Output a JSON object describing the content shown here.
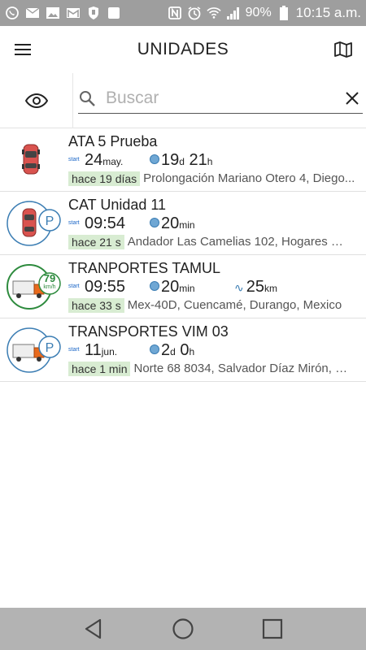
{
  "status_bar": {
    "icons": [
      "whatsapp-icon",
      "mail-icon",
      "image-icon",
      "gmail-icon",
      "shield-icon",
      "square-app-icon",
      "nfc-icon",
      "alarm-icon",
      "wifi-icon",
      "signal-icon",
      "battery-icon"
    ],
    "battery": "90%",
    "time": "10:15 a.m."
  },
  "appbar": {
    "title": "UNIDADES",
    "menu_icon": "menu-icon",
    "map_icon": "map-icon"
  },
  "search": {
    "placeholder": "Buscar",
    "value": "",
    "eye_icon": "eye-icon",
    "search_icon": "search-icon",
    "clear_icon": "close-icon"
  },
  "units": [
    {
      "name": "ATA 5 Prueba",
      "icon": "car-icon",
      "start_label": "start",
      "start_main": "24",
      "start_unit": "may.",
      "duration_a": "19",
      "duration_a_unit": "d",
      "duration_b": "21",
      "duration_b_unit": "h",
      "distance": "",
      "distance_unit": "",
      "ago": "hace 19 días",
      "address": "Prolongación Mariano Otero 4, Diego..."
    },
    {
      "name": "CAT Unidad 11",
      "icon": "car-parked-icon",
      "start_label": "start",
      "start_main": "09:54",
      "start_unit": "",
      "duration_a": "20",
      "duration_a_unit": "min",
      "duration_b": "",
      "duration_b_unit": "",
      "distance": "",
      "distance_unit": "",
      "ago": "hace 21 s",
      "address": "Andador Las Camelias 102, Hogares Fe..."
    },
    {
      "name": "TRANPORTES TAMUL",
      "icon": "truck-moving-icon",
      "speed": "79",
      "speed_unit": "km/h",
      "start_label": "start",
      "start_main": "09:55",
      "start_unit": "",
      "duration_a": "20",
      "duration_a_unit": "min",
      "duration_b": "",
      "duration_b_unit": "",
      "distance": "25",
      "distance_unit": "km",
      "ago": "hace 33 s",
      "address": "Mex-40D, Cuencamé, Durango, Mexico"
    },
    {
      "name": "TRANSPORTES VIM 03",
      "icon": "truck-parked-icon",
      "start_label": "start",
      "start_main": "11",
      "start_unit": "jun.",
      "duration_a": "2",
      "duration_a_unit": "d",
      "duration_b": "0",
      "duration_b_unit": "h",
      "distance": "",
      "distance_unit": "",
      "ago": "hace 1 min",
      "address": "Norte 68 8034, Salvador Díaz Mirón, Di..."
    }
  ],
  "navbar": {
    "back_icon": "back-triangle-icon",
    "home_icon": "home-circle-icon",
    "recents_icon": "recents-square-icon"
  },
  "colors": {
    "status_bar": "#9e9e9e",
    "nav_bar": "#b3b3b3",
    "ago_badge": "#d8ecd2",
    "moving_ring": "#2e8b3e",
    "parked_ring": "#3b7db3",
    "car_body": "#d9534f"
  }
}
